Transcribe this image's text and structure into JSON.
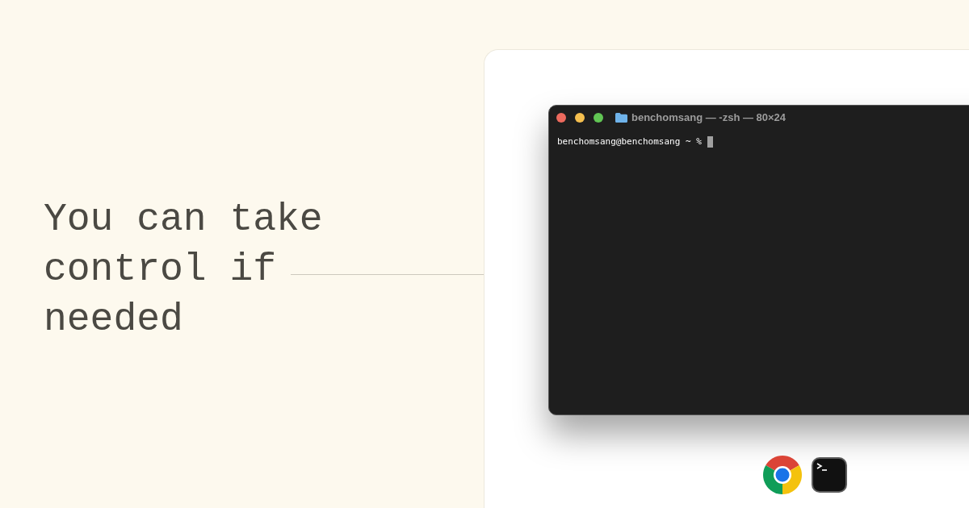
{
  "heading": "You can take control if needed",
  "terminal": {
    "window_buttons": [
      {
        "color": "#ed6a5e"
      },
      {
        "color": "#f5bf4f"
      },
      {
        "color": "#61c554"
      }
    ],
    "title": "benchomsang — -zsh — 80×24",
    "prompt": "benchomsang@benchomsang ~ %"
  },
  "dock": [
    {
      "kind": "browser"
    },
    {
      "kind": "terminal"
    }
  ]
}
